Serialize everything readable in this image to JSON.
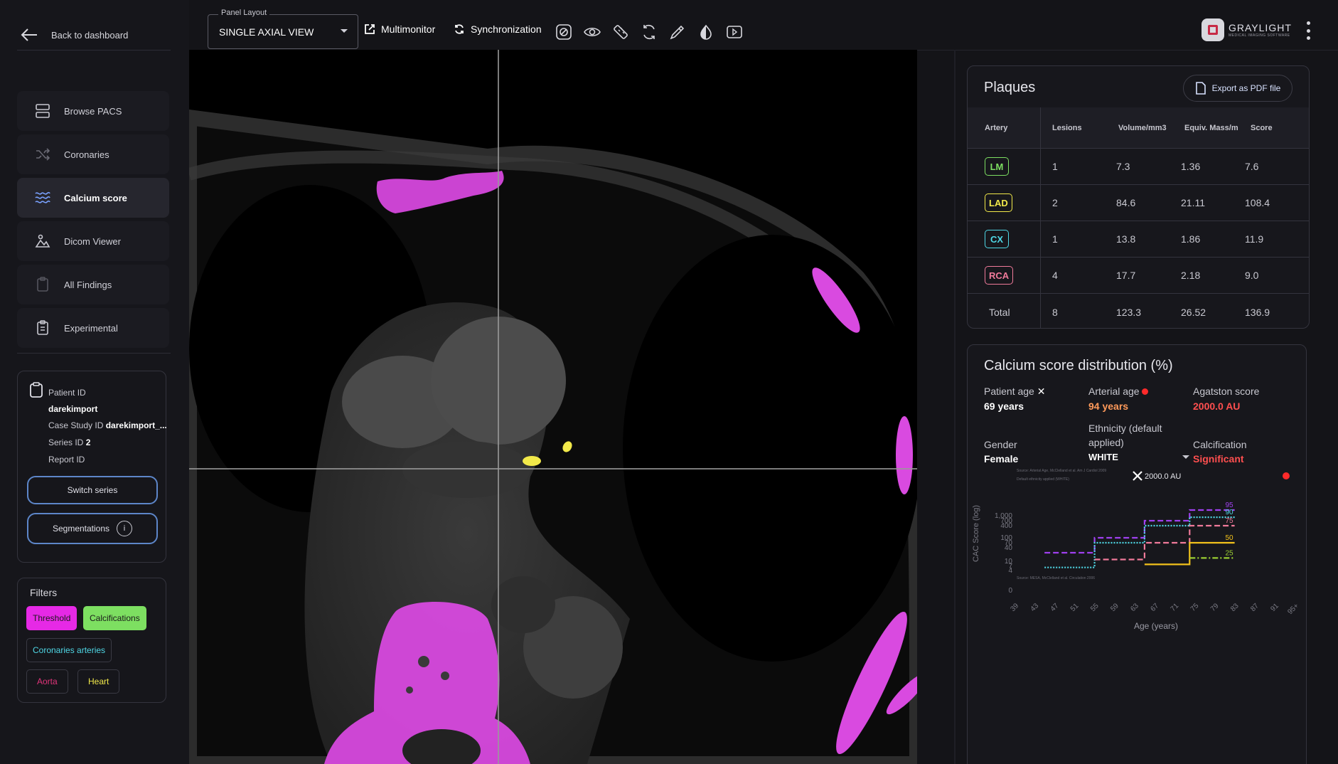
{
  "nav": {
    "back_label": "Back to dashboard",
    "items": [
      {
        "label": "Browse PACS",
        "icon": "server-icon"
      },
      {
        "label": "Coronaries",
        "icon": "shuffle-icon"
      },
      {
        "label": "Calcium score",
        "icon": "waves-icon",
        "active": true
      },
      {
        "label": "Dicom Viewer",
        "icon": "image-icon"
      },
      {
        "label": "All Findings",
        "icon": "clipboard-icon"
      },
      {
        "label": "Experimental",
        "icon": "clipboard-list-icon"
      }
    ]
  },
  "patient": {
    "patient_id_label": "Patient ID",
    "patient_id_value": "darekimport",
    "case_label": "Case Study ID",
    "case_value": "darekimport_...",
    "series_label": "Series ID",
    "series_value": "2",
    "report_label": "Report ID",
    "switch_series": "Switch series",
    "segmentations": "Segmentations",
    "info_glyph": "i"
  },
  "filters": {
    "title": "Filters",
    "chips": [
      {
        "label": "Threshold",
        "bg": "#e629e6",
        "fg": "#1a1a1a",
        "border": "#e629e6"
      },
      {
        "label": "Calcifications",
        "bg": "#7ddf61",
        "fg": "#1a1a1a",
        "border": "#7ddf61"
      },
      {
        "label": "Coronaries arteries",
        "bg": "transparent",
        "fg": "#4fd8e6",
        "border": "#3a3a44"
      },
      {
        "label": "Aorta",
        "bg": "transparent",
        "fg": "#e0347a",
        "border": "#3a3a44"
      },
      {
        "label": "Heart",
        "bg": "transparent",
        "fg": "#f2e94a",
        "border": "#3a3a44"
      }
    ]
  },
  "toolbar": {
    "panel_layout_label": "Panel Layout",
    "panel_layout_value": "SINGLE AXIAL VIEW",
    "multimonitor": "Multimonitor",
    "synchronization": "Synchronization",
    "tools": [
      "window-level-icon",
      "eye-icon",
      "ruler-icon",
      "rotate-icon",
      "pipette-icon",
      "contrast-icon",
      "video-icon"
    ]
  },
  "brand": {
    "name": "GRAYLIGHT",
    "tagline": "MEDICAL IMAGING SOFTWARE"
  },
  "plaques": {
    "title": "Plaques",
    "export_label": "Export as PDF file",
    "headers": [
      "Artery",
      "Lesions",
      "Volume/mm3",
      "Equiv. Mass/m",
      "Score"
    ],
    "rows": [
      {
        "artery": "LM",
        "color": "#7ddf61",
        "lesions": "1",
        "volume": "7.3",
        "mass": "1.36",
        "score": "7.6"
      },
      {
        "artery": "LAD",
        "color": "#f2e94a",
        "lesions": "2",
        "volume": "84.6",
        "mass": "21.11",
        "score": "108.4"
      },
      {
        "artery": "CX",
        "color": "#4fd8e6",
        "lesions": "1",
        "volume": "13.8",
        "mass": "1.86",
        "score": "11.9"
      },
      {
        "artery": "RCA",
        "color": "#f07a9a",
        "lesions": "4",
        "volume": "17.7",
        "mass": "2.18",
        "score": "9.0"
      },
      {
        "artery": "Total",
        "color": "",
        "lesions": "8",
        "volume": "123.3",
        "mass": "26.52",
        "score": "136.9"
      }
    ]
  },
  "distribution": {
    "title": "Calcium score distribution (%)",
    "patient_age_label": "Patient age",
    "patient_age_value": "69 years",
    "arterial_age_label": "Arterial age",
    "arterial_age_value": "94 years",
    "agatston_label": "Agatston score",
    "agatston_value": "2000.0 AU",
    "gender_label": "Gender",
    "gender_value": "Female",
    "ethnicity_label": "Ethnicity (default applied)",
    "ethnicity_value": "WHITE",
    "calcification_label": "Calcification",
    "calcification_value": "Significant",
    "colors": {
      "accent": "#ff4f4f",
      "orange": "#ff9a5a"
    }
  },
  "chart_data": {
    "type": "line",
    "title": "",
    "xlabel": "Age (years)",
    "ylabel": "CAC Score (log)",
    "x_ticks": [
      "39",
      "43",
      "47",
      "51",
      "55",
      "59",
      "63",
      "67",
      "71",
      "75",
      "79",
      "83",
      "87",
      "91",
      "95+"
    ],
    "y_ticks": [
      "1,000",
      "700",
      "400",
      "100",
      "70",
      "40",
      "10",
      "7",
      "4",
      "0"
    ],
    "source_top": "Source: Arterial Age, McClelland et al. Am J Cardiol 2009",
    "source_top2": "Default ethnicity applied (WHITE)",
    "source_bottom": "Source: MESA, McClelland et al. Circulation 2006",
    "marker_label": "2000.0 AU",
    "series": [
      {
        "name": "95",
        "color": "#a040f0",
        "style": "dashed",
        "points": [
          [
            45,
            24
          ],
          [
            55,
            24
          ],
          [
            55,
            100
          ],
          [
            65,
            100
          ],
          [
            65,
            700
          ],
          [
            74,
            700
          ],
          [
            74,
            1200
          ],
          [
            83,
            1200
          ]
        ]
      },
      {
        "name": "90",
        "color": "#4fd8e6",
        "style": "dotted",
        "points": [
          [
            45,
            6
          ],
          [
            55,
            6
          ],
          [
            55,
            70
          ],
          [
            65,
            70
          ],
          [
            65,
            400
          ],
          [
            74,
            400
          ],
          [
            74,
            900
          ],
          [
            83,
            900
          ]
        ]
      },
      {
        "name": "75",
        "color": "#f07a9a",
        "style": "dashed",
        "points": [
          [
            55,
            12
          ],
          [
            65,
            12
          ],
          [
            65,
            70
          ],
          [
            74,
            70
          ],
          [
            74,
            400
          ],
          [
            83,
            400
          ]
        ]
      },
      {
        "name": "50",
        "color": "#f2c21b",
        "style": "solid",
        "points": [
          [
            65,
            8
          ],
          [
            74,
            8
          ],
          [
            74,
            70
          ],
          [
            83,
            70
          ]
        ]
      },
      {
        "name": "25",
        "color": "#9acd32",
        "style": "dashdot",
        "points": [
          [
            74,
            14
          ],
          [
            83,
            14
          ]
        ]
      }
    ],
    "patient_marker": {
      "age": 69,
      "score": 2000
    }
  }
}
